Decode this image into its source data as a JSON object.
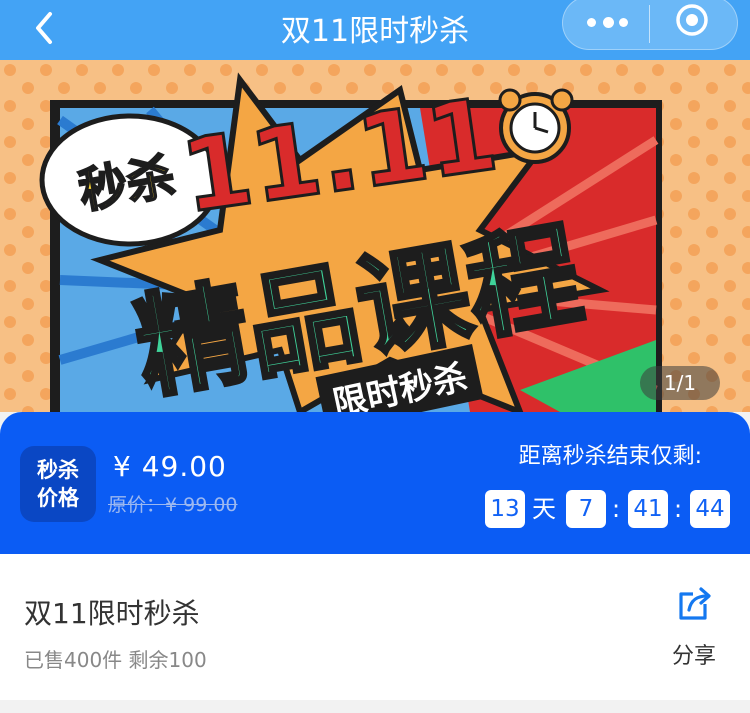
{
  "header": {
    "title": "双11限时秒杀",
    "back_icon": "chevron-left-icon",
    "more_icon": "more-dots-icon",
    "close_icon": "target-circle-icon"
  },
  "banner": {
    "badge": "秒杀",
    "date": "11.11",
    "headline": "精品课程",
    "ribbon": "限时秒杀",
    "pager": "1/1"
  },
  "flash_sale": {
    "tag_line1": "秒杀",
    "tag_line2": "价格",
    "price": "¥ 49.00",
    "original_price": "原价：¥ 99.00",
    "countdown_label": "距离秒杀结束仅剩:",
    "days": "13",
    "days_unit": "天",
    "hours": "7",
    "minutes": "41",
    "seconds": "44",
    "separator": ":"
  },
  "product": {
    "title": "双11限时秒杀",
    "sales": "已售400件 剩余100",
    "share_label": "分享",
    "share_icon": "share-arrow-icon"
  },
  "colors": {
    "header_blue": "#43a3f5",
    "price_blue": "#0b5cf4",
    "countdown_text": "#1162f5"
  }
}
